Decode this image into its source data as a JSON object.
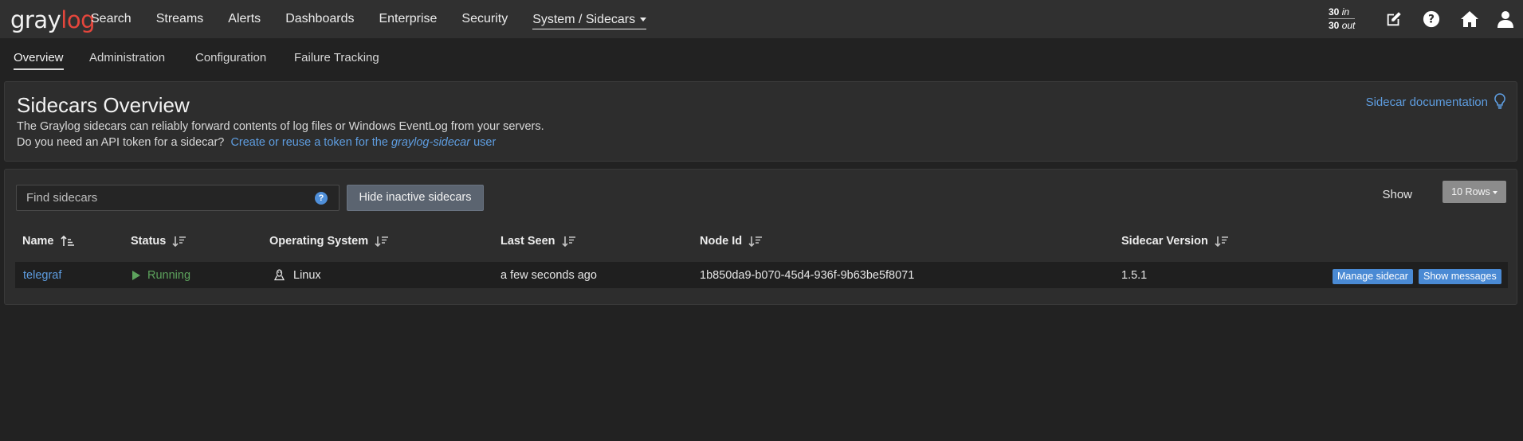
{
  "navbar": {
    "logo_gray": "gray",
    "logo_log": "log",
    "items": [
      {
        "label": "Search"
      },
      {
        "label": "Streams"
      },
      {
        "label": "Alerts"
      },
      {
        "label": "Dashboards"
      },
      {
        "label": "Enterprise"
      },
      {
        "label": "Security"
      },
      {
        "label": "System / Sidecars"
      }
    ],
    "throughput": {
      "in_count": "30",
      "in_label": "in",
      "out_count": "30",
      "out_label": "out"
    },
    "icons": [
      "edit-icon",
      "help-icon",
      "home-icon",
      "user-icon"
    ]
  },
  "subnav": {
    "items": [
      {
        "label": "Overview"
      },
      {
        "label": "Administration"
      },
      {
        "label": "Configuration"
      },
      {
        "label": "Failure Tracking"
      }
    ]
  },
  "overview": {
    "title": "Sidecars Overview",
    "description": "The Graylog sidecars can reliably forward contents of log files or Windows EventLog from your servers.",
    "token_question": "Do you need an API token for a sidecar?",
    "token_link_prefix": "Create or reuse a token for the ",
    "token_link_user": "graylog-sidecar",
    "token_link_suffix": " user",
    "doc_link": "Sidecar documentation"
  },
  "list": {
    "search_placeholder": "Find sidecars",
    "hide_inactive_label": "Hide inactive sidecars",
    "show_label": "Show",
    "rows_label": "10 Rows",
    "columns": [
      "Name",
      "Status",
      "Operating System",
      "Last Seen",
      "Node Id",
      "Sidecar Version"
    ],
    "rows": [
      {
        "name": "telegraf",
        "status": "Running",
        "os": "Linux",
        "last_seen": "a few seconds ago",
        "node_id": "1b850da9-b070-45d4-936f-9b63be5f8071",
        "version": "1.5.1",
        "manage_label": "Manage sidecar",
        "messages_label": "Show messages"
      }
    ]
  },
  "colors": {
    "accent": "#5e9de0",
    "running": "#5da35d",
    "logo_red": "#e4463c",
    "button_blue": "#4a8ad4"
  }
}
